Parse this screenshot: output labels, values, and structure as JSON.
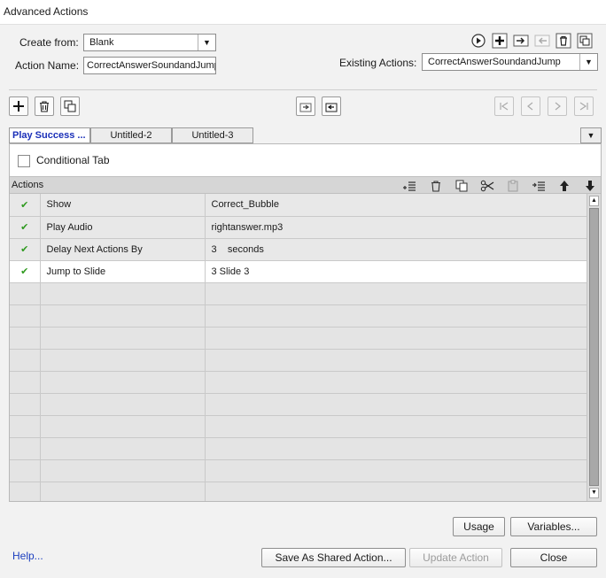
{
  "window": {
    "title": "Advanced Actions"
  },
  "form": {
    "create_from_label": "Create from:",
    "create_from_value": "Blank",
    "action_name_label": "Action Name:",
    "action_name_value": "CorrectAnswerSoundandJump",
    "existing_actions_label": "Existing Actions:",
    "existing_actions_value": "CorrectAnswerSoundandJump"
  },
  "tabs": [
    {
      "label": "Play Success ..."
    },
    {
      "label": "Untitled-2"
    },
    {
      "label": "Untitled-3"
    }
  ],
  "conditional_tab": {
    "label": "Conditional Tab",
    "checked": false
  },
  "actions_panel": {
    "header": "Actions",
    "rows": [
      {
        "action": "Show",
        "target": "Correct_Bubble",
        "valid": true
      },
      {
        "action": "Play Audio",
        "target": "rightanswer.mp3",
        "valid": true
      },
      {
        "action": "Delay Next Actions By",
        "target": "3    seconds",
        "valid": true
      },
      {
        "action": "Jump to Slide",
        "target": "3 Slide 3",
        "valid": true
      }
    ]
  },
  "buttons": {
    "usage": "Usage",
    "variables": "Variables...",
    "help": "Help...",
    "save_shared": "Save As Shared Action...",
    "update_action": "Update Action",
    "close": "Close"
  },
  "colors": {
    "accent": "#1a2fb8",
    "check": "#2f9a1f",
    "selected_row": "#ffffff"
  }
}
